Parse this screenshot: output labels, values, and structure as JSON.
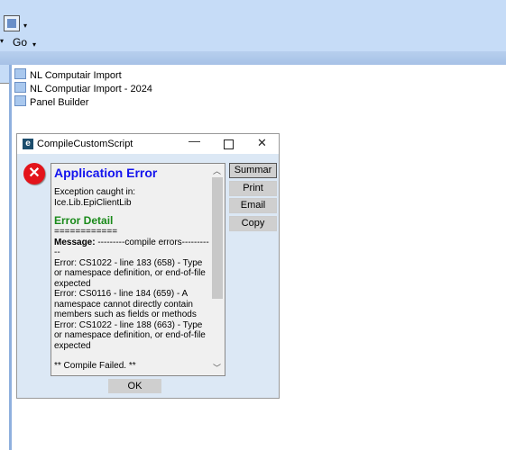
{
  "toolbar": {
    "go_label": "Go",
    "dropdown_glyph": "▾",
    "icon": "grid-view-icon"
  },
  "tree": {
    "items": [
      {
        "label": "NL Computair Import"
      },
      {
        "label": "NL Computiar Import - 2024"
      },
      {
        "label": "Panel Builder"
      }
    ]
  },
  "dialog": {
    "title": "CompileCustomScript",
    "app_icon_letter": "e",
    "error_icon": "error-x-icon",
    "heading": "Application Error",
    "exception": "Exception caught in: Ice.Lib.EpiClientLib",
    "detail_heading": "Error Detail",
    "separator": "============",
    "message_label": "Message:",
    "message_text": " ---------compile errors-----------",
    "errors": [
      "Error: CS1022 - line 183 (658) - Type or namespace definition, or end-of-file expected",
      "Error: CS0116 - line 184 (659) - A namespace cannot directly contain members such as fields or methods",
      "Error: CS1022 - line 188 (663) - Type or namespace definition, or end-of-file expected"
    ],
    "footer": "** Compile Failed. **",
    "buttons": {
      "summary": "Summar",
      "print": "Print",
      "email": "Email",
      "copy": "Copy",
      "ok": "OK"
    }
  }
}
